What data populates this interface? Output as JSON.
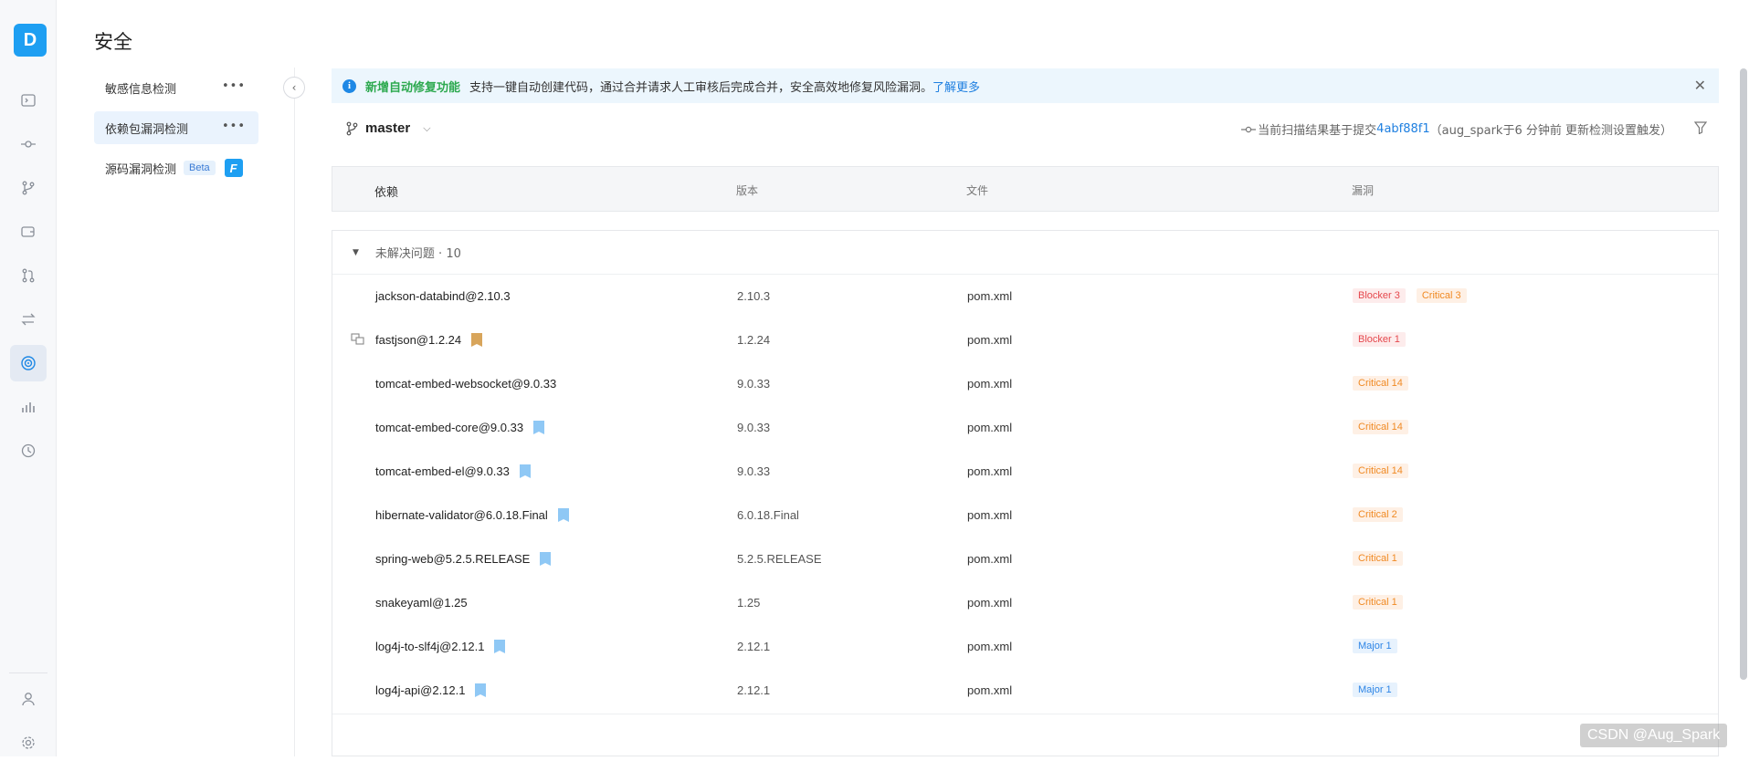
{
  "rail": {
    "logo_letter": "D",
    "items": [
      "terminal-icon",
      "commit-icon",
      "branch-icon",
      "tag-icon",
      "merge-request-icon",
      "compare-icon",
      "security-icon",
      "chart-icon",
      "history-icon"
    ],
    "active": "security-icon",
    "bottom_items": [
      "user-icon",
      "settings-icon"
    ]
  },
  "page": {
    "title": "安全"
  },
  "subnav": {
    "items": [
      {
        "label": "敏感信息检测",
        "more": "•••"
      },
      {
        "label": "依赖包漏洞检测",
        "more": "•••",
        "active": true
      },
      {
        "label": "源码漏洞检测",
        "badge": "Beta",
        "logo": "F"
      }
    ],
    "collapse_glyph": "‹"
  },
  "banner": {
    "info_glyph": "i",
    "highlight": "新增自动修复功能",
    "text": "支持一键自动创建代码，通过合并请求人工审核后完成合并，安全高效地修复风险漏洞。",
    "link": "了解更多",
    "close_glyph": "✕"
  },
  "branch": {
    "name": "master",
    "caret": "⌵"
  },
  "scan": {
    "prefix": "当前扫描结果基于提交",
    "commit": "4abf88f1",
    "suffix": "（aug_spark于6 分钟前 更新检测设置触发）"
  },
  "table": {
    "headers": {
      "dep": "依赖",
      "version": "版本",
      "file": "文件",
      "vuln": "漏洞"
    },
    "group_label": "未解决问题 · 10",
    "group_tri": "▼",
    "rows": [
      {
        "dep": "jackson-databind@2.10.3",
        "version": "2.10.3",
        "file": "pom.xml",
        "badge": "",
        "tags": [
          {
            "label": "Blocker 3",
            "level": "blocker"
          },
          {
            "label": "Critical 3",
            "level": "critical"
          }
        ]
      },
      {
        "dep": "fastjson@1.2.24",
        "version": "1.2.24",
        "file": "pom.xml",
        "badge": "gold",
        "row_icon": "copy-icon",
        "tags": [
          {
            "label": "Blocker 1",
            "level": "blocker"
          }
        ]
      },
      {
        "dep": "tomcat-embed-websocket@9.0.33",
        "version": "9.0.33",
        "file": "pom.xml",
        "badge": "",
        "tags": [
          {
            "label": "Critical 14",
            "level": "critical"
          }
        ]
      },
      {
        "dep": "tomcat-embed-core@9.0.33",
        "version": "9.0.33",
        "file": "pom.xml",
        "badge": "blue",
        "tags": [
          {
            "label": "Critical 14",
            "level": "critical"
          }
        ]
      },
      {
        "dep": "tomcat-embed-el@9.0.33",
        "version": "9.0.33",
        "file": "pom.xml",
        "badge": "blue",
        "tags": [
          {
            "label": "Critical 14",
            "level": "critical"
          }
        ]
      },
      {
        "dep": "hibernate-validator@6.0.18.Final",
        "version": "6.0.18.Final",
        "file": "pom.xml",
        "badge": "blue",
        "tags": [
          {
            "label": "Critical 2",
            "level": "critical"
          }
        ]
      },
      {
        "dep": "spring-web@5.2.5.RELEASE",
        "version": "5.2.5.RELEASE",
        "file": "pom.xml",
        "badge": "blue",
        "tags": [
          {
            "label": "Critical 1",
            "level": "critical"
          }
        ]
      },
      {
        "dep": "snakeyaml@1.25",
        "version": "1.25",
        "file": "pom.xml",
        "badge": "",
        "tags": [
          {
            "label": "Critical 1",
            "level": "critical"
          }
        ]
      },
      {
        "dep": "log4j-to-slf4j@2.12.1",
        "version": "2.12.1",
        "file": "pom.xml",
        "badge": "blue",
        "tags": [
          {
            "label": "Major 1",
            "level": "major"
          }
        ]
      },
      {
        "dep": "log4j-api@2.12.1",
        "version": "2.12.1",
        "file": "pom.xml",
        "badge": "blue",
        "tags": [
          {
            "label": "Major 1",
            "level": "major"
          }
        ]
      }
    ]
  },
  "watermark": "CSDN @Aug_Spark",
  "colors": {
    "accent": "#1e9ff2",
    "blocker": "#e5484d",
    "critical": "#f08a24",
    "major": "#2f86e6",
    "highlight": "#2da94f"
  }
}
